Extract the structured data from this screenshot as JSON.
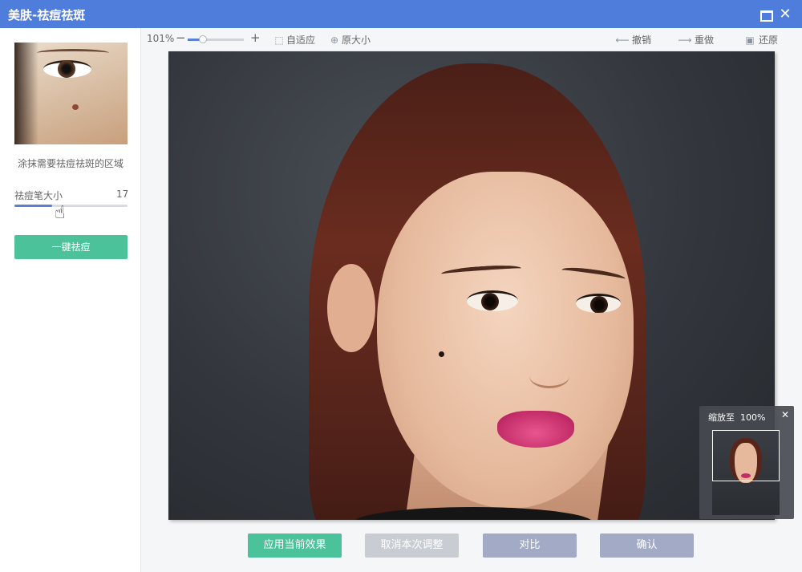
{
  "window": {
    "title": "美肤-祛痘祛斑"
  },
  "sidebar": {
    "hint": "涂抹需要祛痘祛斑的区域",
    "brush_size_label": "祛痘笔大小",
    "brush_size_value": "17",
    "brush_size_fraction": 0.33,
    "one_click_label": "一键祛痘"
  },
  "toolbar": {
    "zoom_value": "101%",
    "fit_label": "自适应",
    "original_size_label": "原大小",
    "undo_label": "撤销",
    "redo_label": "重做",
    "restore_label": "还原"
  },
  "zoom_popup": {
    "label": "缩放至",
    "value": "100%"
  },
  "actions": {
    "apply_label": "应用当前效果",
    "cancel_label": "取消本次调整",
    "compare_label": "对比",
    "confirm_label": "确认"
  },
  "colors": {
    "titlebar": "#4f7ddb",
    "green_button": "#4cc29a",
    "slider_fill": "#5a7fd6"
  },
  "icons": [
    "maximize-icon",
    "close-icon",
    "fit-icon",
    "original-size-icon",
    "undo-arrow-icon",
    "redo-arrow-icon",
    "restore-image-icon",
    "hand-cursor-icon"
  ]
}
